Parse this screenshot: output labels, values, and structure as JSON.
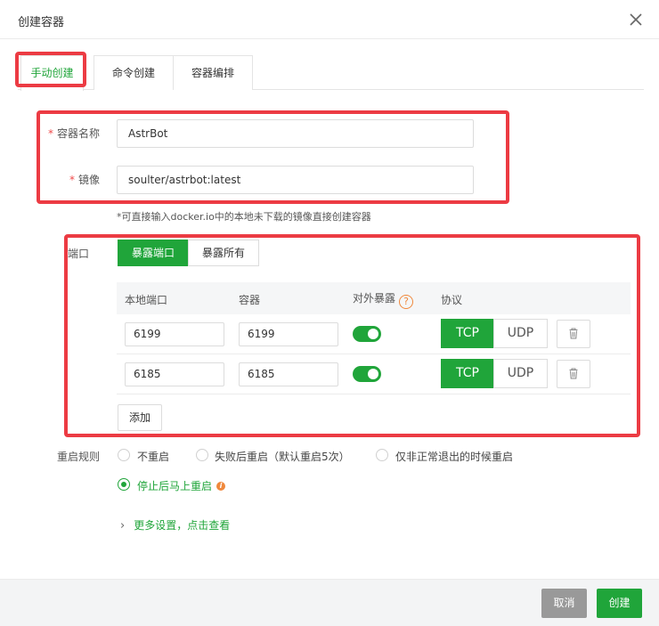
{
  "dialog": {
    "title": "创建容器"
  },
  "tabs": [
    {
      "label": "手动创建",
      "active": true
    },
    {
      "label": "命令创建",
      "active": false
    },
    {
      "label": "容器编排",
      "active": false
    }
  ],
  "form": {
    "name_label": "容器名称",
    "name_value": "AstrBot",
    "image_label": "镜像",
    "image_value": "soulter/astrbot:latest",
    "hint": "*可直接输入docker.io中的本地未下载的镜像直接创建容器"
  },
  "ports": {
    "label": "端口",
    "mode_options": [
      {
        "label": "暴露端口",
        "selected": true
      },
      {
        "label": "暴露所有",
        "selected": false
      }
    ],
    "columns": {
      "local": "本地端口",
      "container": "容器",
      "expose": "对外暴露",
      "protocol": "协议"
    },
    "help_glyph": "?",
    "rows": [
      {
        "local": "6199",
        "container": "6199",
        "expose": true,
        "protocol": "TCP"
      },
      {
        "local": "6185",
        "container": "6185",
        "expose": true,
        "protocol": "TCP"
      }
    ],
    "protocol_options": [
      "TCP",
      "UDP"
    ],
    "add_label": "添加"
  },
  "restart": {
    "label": "重启规则",
    "options": [
      {
        "label": "不重启",
        "checked": false
      },
      {
        "label": "失败后重启（默认重启5次）",
        "checked": false
      },
      {
        "label": "仅非正常退出的时候重启",
        "checked": false
      },
      {
        "label": "停止后马上重启",
        "checked": true
      }
    ],
    "info_glyph": "i"
  },
  "more": {
    "label": "更多设置，点击查看"
  },
  "footer": {
    "cancel_label": "取消",
    "create_label": "创建"
  },
  "colors": {
    "accent": "#20a53a",
    "highlight": "#ec3b43",
    "cancel": "#999999",
    "warning": "#f0883c"
  }
}
